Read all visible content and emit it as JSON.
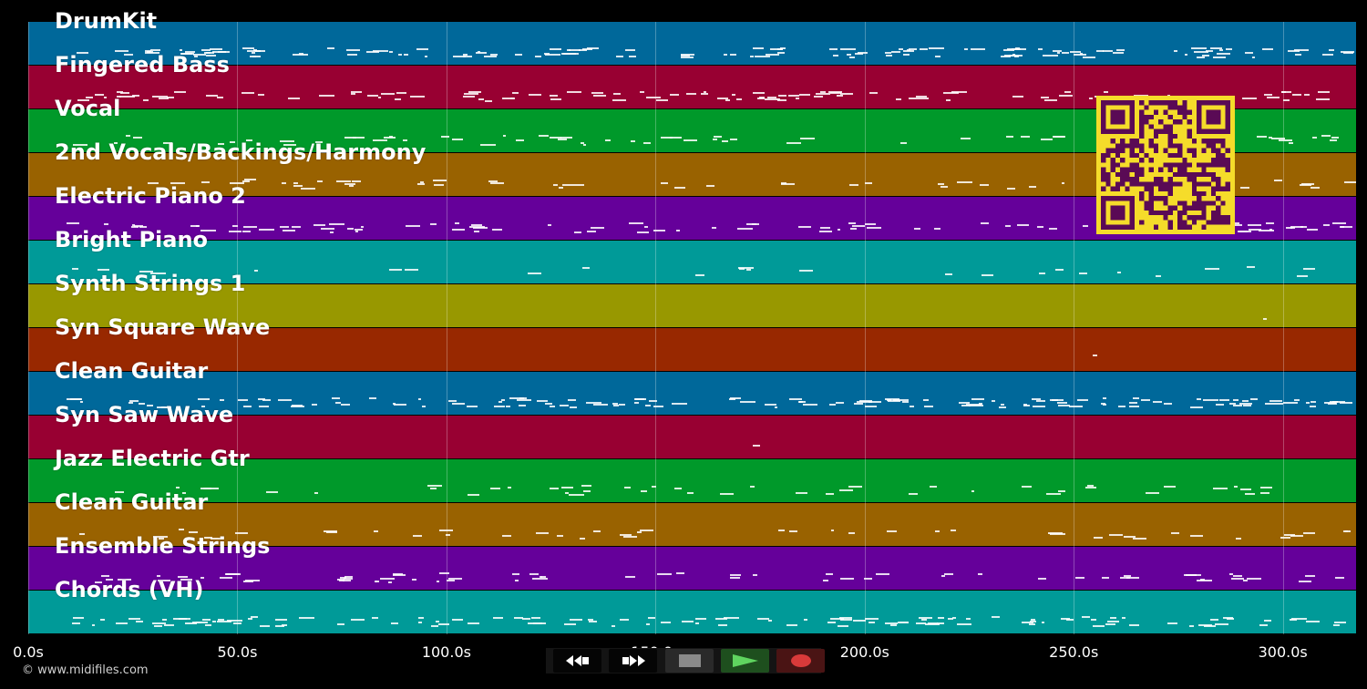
{
  "tracks": [
    {
      "name": "DrumKit",
      "color": "#00689a"
    },
    {
      "name": "Fingered Bass",
      "color": "#980032"
    },
    {
      "name": "Vocal",
      "color": "#00992a"
    },
    {
      "name": "2nd Vocals/Backings/Harmony",
      "color": "#996200"
    },
    {
      "name": "Electric Piano 2",
      "color": "#65009a"
    },
    {
      "name": "Bright Piano",
      "color": "#009a98"
    },
    {
      "name": "Synth Strings 1",
      "color": "#989800"
    },
    {
      "name": "Syn Square Wave",
      "color": "#982800"
    },
    {
      "name": "Clean Guitar",
      "color": "#00689a"
    },
    {
      "name": "Syn Saw Wave",
      "color": "#980032"
    },
    {
      "name": "Jazz Electric Gtr",
      "color": "#00992a"
    },
    {
      "name": "Clean Guitar",
      "color": "#996200"
    },
    {
      "name": "Ensemble Strings",
      "color": "#65009a"
    },
    {
      "name": "Chords (VH)",
      "color": "#009a98"
    }
  ],
  "timeline": {
    "ticks": [
      "0.0s",
      "50.0s",
      "100.0s",
      "150.0s",
      "200.0s",
      "250.0s",
      "300.0s"
    ],
    "tick_values": [
      0,
      50,
      100,
      150,
      200,
      250,
      300
    ],
    "max_seconds": 317.5
  },
  "transport": {
    "rewind_icon": "rewind-icon",
    "fastforward_icon": "fast-forward-icon",
    "stop_icon": "stop-icon",
    "play_icon": "play-icon",
    "record_icon": "record-icon"
  },
  "footer": {
    "copyright": "© www.midifiles.com"
  },
  "colors": {
    "background": "#000000",
    "qr_fg": "#5a0a55",
    "qr_bg": "#f5dc2a"
  }
}
